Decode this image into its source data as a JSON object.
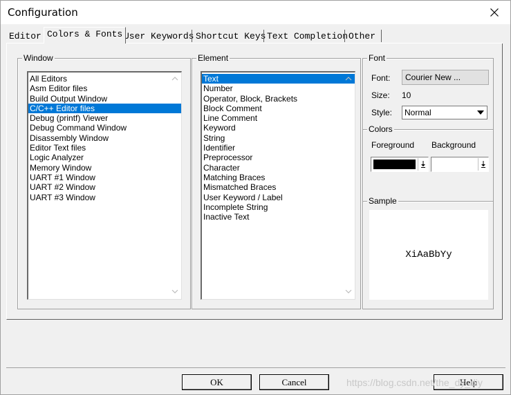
{
  "window": {
    "title": "Configuration"
  },
  "tabs": [
    {
      "label": "Editor",
      "active": false
    },
    {
      "label": "Colors & Fonts",
      "active": true
    },
    {
      "label": "User Keywords",
      "active": false
    },
    {
      "label": "Shortcut Keys",
      "active": false
    },
    {
      "label": "Text Completion",
      "active": false
    },
    {
      "label": "Other",
      "active": false
    }
  ],
  "window_group": {
    "label": "Window",
    "items": [
      "All Editors",
      "Asm Editor files",
      "Build Output Window",
      "C/C++ Editor files",
      "Debug (printf) Viewer",
      "Debug Command Window",
      "Disassembly Window",
      "Editor Text files",
      "Logic Analyzer",
      "Memory Window",
      "UART #1 Window",
      "UART #2 Window",
      "UART #3 Window"
    ],
    "selected": "C/C++ Editor files"
  },
  "element_group": {
    "label": "Element",
    "items": [
      "Text",
      "Number",
      "Operator, Block, Brackets",
      "Block Comment",
      "Line Comment",
      "Keyword",
      "String",
      "Identifier",
      "Preprocessor",
      "Character",
      "Matching Braces",
      "Mismatched Braces",
      "User Keyword / Label",
      "Incomplete String",
      "Inactive Text"
    ],
    "selected": "Text"
  },
  "font_group": {
    "label": "Font",
    "font_label": "Font:",
    "font_button": "Courier New ...",
    "size_label": "Size:",
    "size_value": "10",
    "style_label": "Style:",
    "style_value": "Normal"
  },
  "colors_group": {
    "label": "Colors",
    "foreground_label": "Foreground",
    "background_label": "Background",
    "foreground_color": "#000000",
    "background_color": "#ffffff"
  },
  "sample_group": {
    "label": "Sample",
    "text": "XiAaBbYy"
  },
  "buttons": {
    "ok": "OK",
    "cancel": "Cancel",
    "help": "Help"
  },
  "watermark": "https://blog.csdn.net/the_dy_diy",
  "accent_color": "#0078d7"
}
